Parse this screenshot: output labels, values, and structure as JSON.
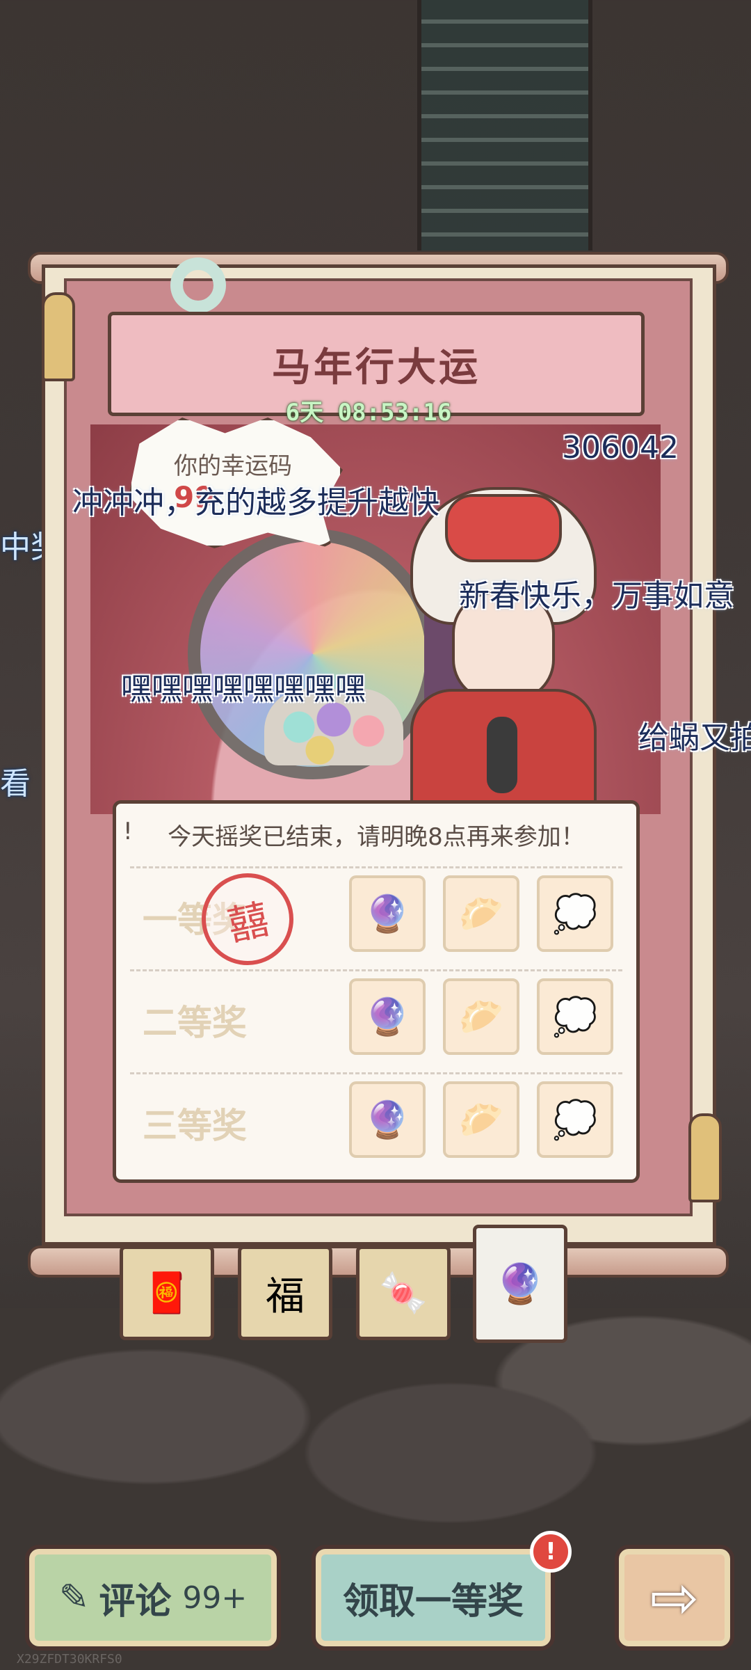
{
  "event": {
    "title": "马年行大运",
    "countdown": "6天  08:53:16"
  },
  "lucky_code": {
    "label": "你的幸运码",
    "value": "99"
  },
  "danmaku": [
    {
      "text": "冲冲冲，充的越多提升越快"
    },
    {
      "text": "306042"
    },
    {
      "text": "新春快乐，万事如意"
    },
    {
      "text": "嘿嘿嘿嘿嘿嘿嘿嘿"
    },
    {
      "text": "给蜗又拍"
    },
    {
      "text": "中奖"
    },
    {
      "text": "看"
    }
  ],
  "draw_notice": "今天摇奖已结束，请明晚8点再来参加！",
  "notice_icon": "!",
  "prizes": [
    {
      "label": "一等奖",
      "items": [
        "crystal-ball-icon",
        "dumpling-icon",
        "tadpole-icon"
      ],
      "stamped": true
    },
    {
      "label": "二等奖",
      "items": [
        "crystal-ball-icon",
        "dumpling-icon",
        "tadpole-icon"
      ],
      "stamped": false
    },
    {
      "label": "三等奖",
      "items": [
        "crystal-ball-icon",
        "dumpling-icon",
        "tadpole-icon"
      ],
      "stamped": false
    }
  ],
  "item_glyphs": {
    "crystal": "🔮",
    "dumpling": "🥟",
    "tadpole": "💭",
    "stamp": "囍"
  },
  "tabs": [
    {
      "name": "red-envelope-tab",
      "glyph": "🧧",
      "active": false
    },
    {
      "name": "fu-tab",
      "glyph": "福",
      "active": false
    },
    {
      "name": "candy-tab",
      "glyph": "🍬",
      "active": false
    },
    {
      "name": "lottery-tab",
      "glyph": "🔮",
      "active": true
    }
  ],
  "buttons": {
    "comment_label": "评论",
    "comment_count": "99+",
    "claim_label": "领取一等奖",
    "claim_badge": "!",
    "next_glyph": "⇨"
  },
  "watermark": "X29ZFDT30KRFS0",
  "colors": {
    "accent": "#c98a8e",
    "title_text": "#7a3b3e",
    "timer": "#c8f5c4",
    "badge": "#e0483f"
  }
}
